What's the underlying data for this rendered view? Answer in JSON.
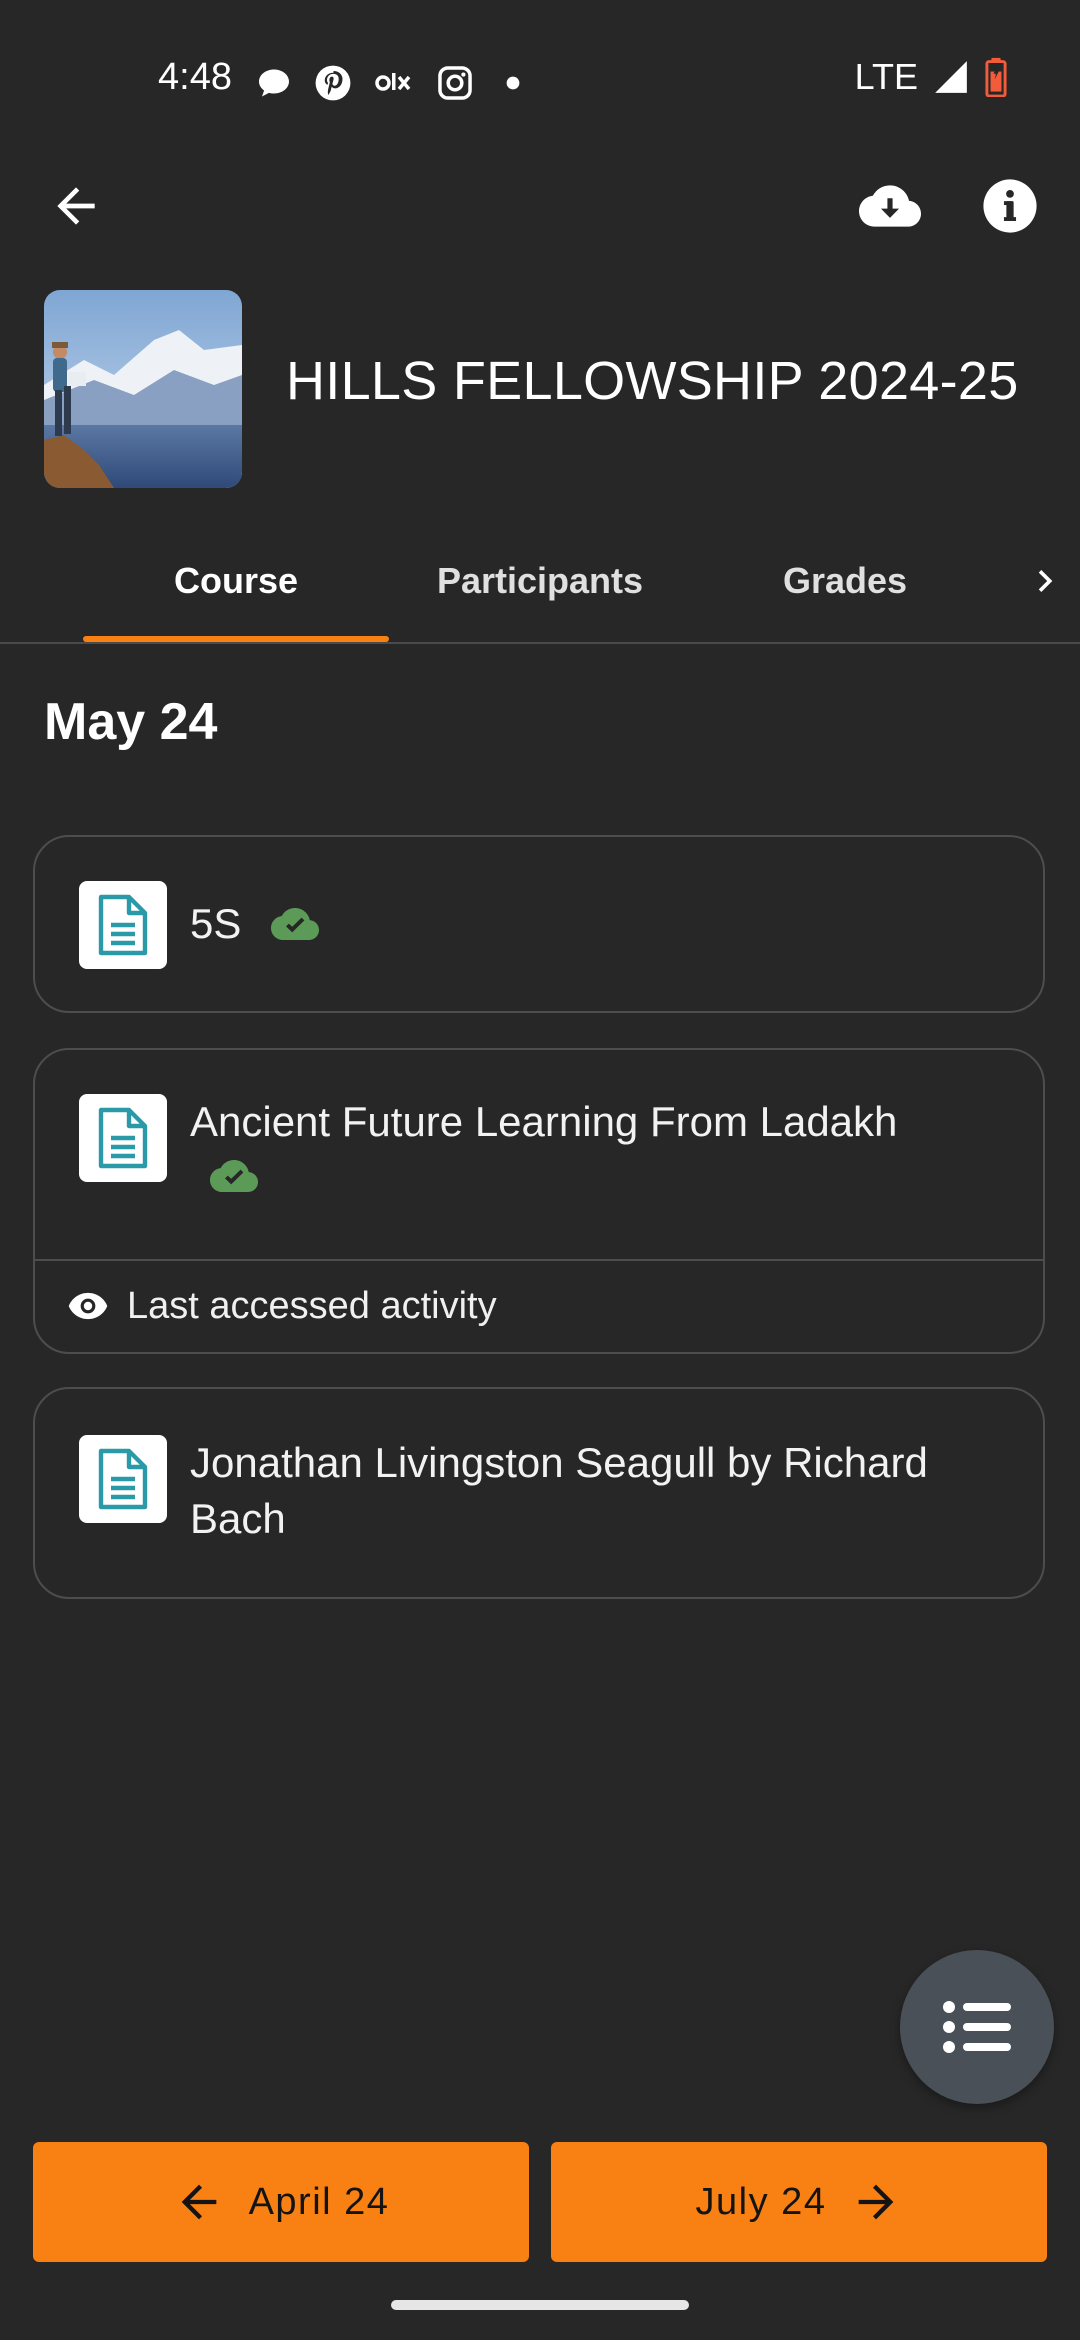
{
  "status_bar": {
    "time": "4:48",
    "network": "LTE",
    "notification_icons": [
      "chat-bubble-icon",
      "pinterest-icon",
      "olx-icon",
      "instagram-icon",
      "dot-icon"
    ],
    "battery_color": "#f25c3a"
  },
  "app_bar": {
    "back_icon": "arrow-left-icon",
    "download_icon": "cloud-download-icon",
    "info_icon": "info-icon"
  },
  "course": {
    "title": "HILLS FELLOWSHIP 2024-25",
    "image": "mountain-hiker-thumbnail"
  },
  "tabs": {
    "items": [
      {
        "label": "Course",
        "active": true
      },
      {
        "label": "Participants",
        "active": false
      },
      {
        "label": "Grades",
        "active": false
      }
    ],
    "more_icon": "chevron-right-icon",
    "accent_color": "#f98012"
  },
  "section": {
    "heading": "May 24"
  },
  "activities": [
    {
      "title": "5S",
      "downloaded": true,
      "icon": "document-icon"
    },
    {
      "title": "Ancient Future Learning From Ladakh",
      "downloaded": true,
      "icon": "document-icon",
      "footer": "Last accessed activity"
    },
    {
      "title": "Jonathan Livingston Seagull by Richard Bach",
      "downloaded": false,
      "icon": "document-icon"
    }
  ],
  "fab": {
    "icon": "list-icon"
  },
  "navigation": {
    "prev_label": "April 24",
    "next_label": "July 24",
    "button_color": "#f98012"
  },
  "colors": {
    "background": "#272727",
    "card_border": "#4d4d4d",
    "download_check": "#5c9b57",
    "doc_icon": "#2b9aa8"
  }
}
